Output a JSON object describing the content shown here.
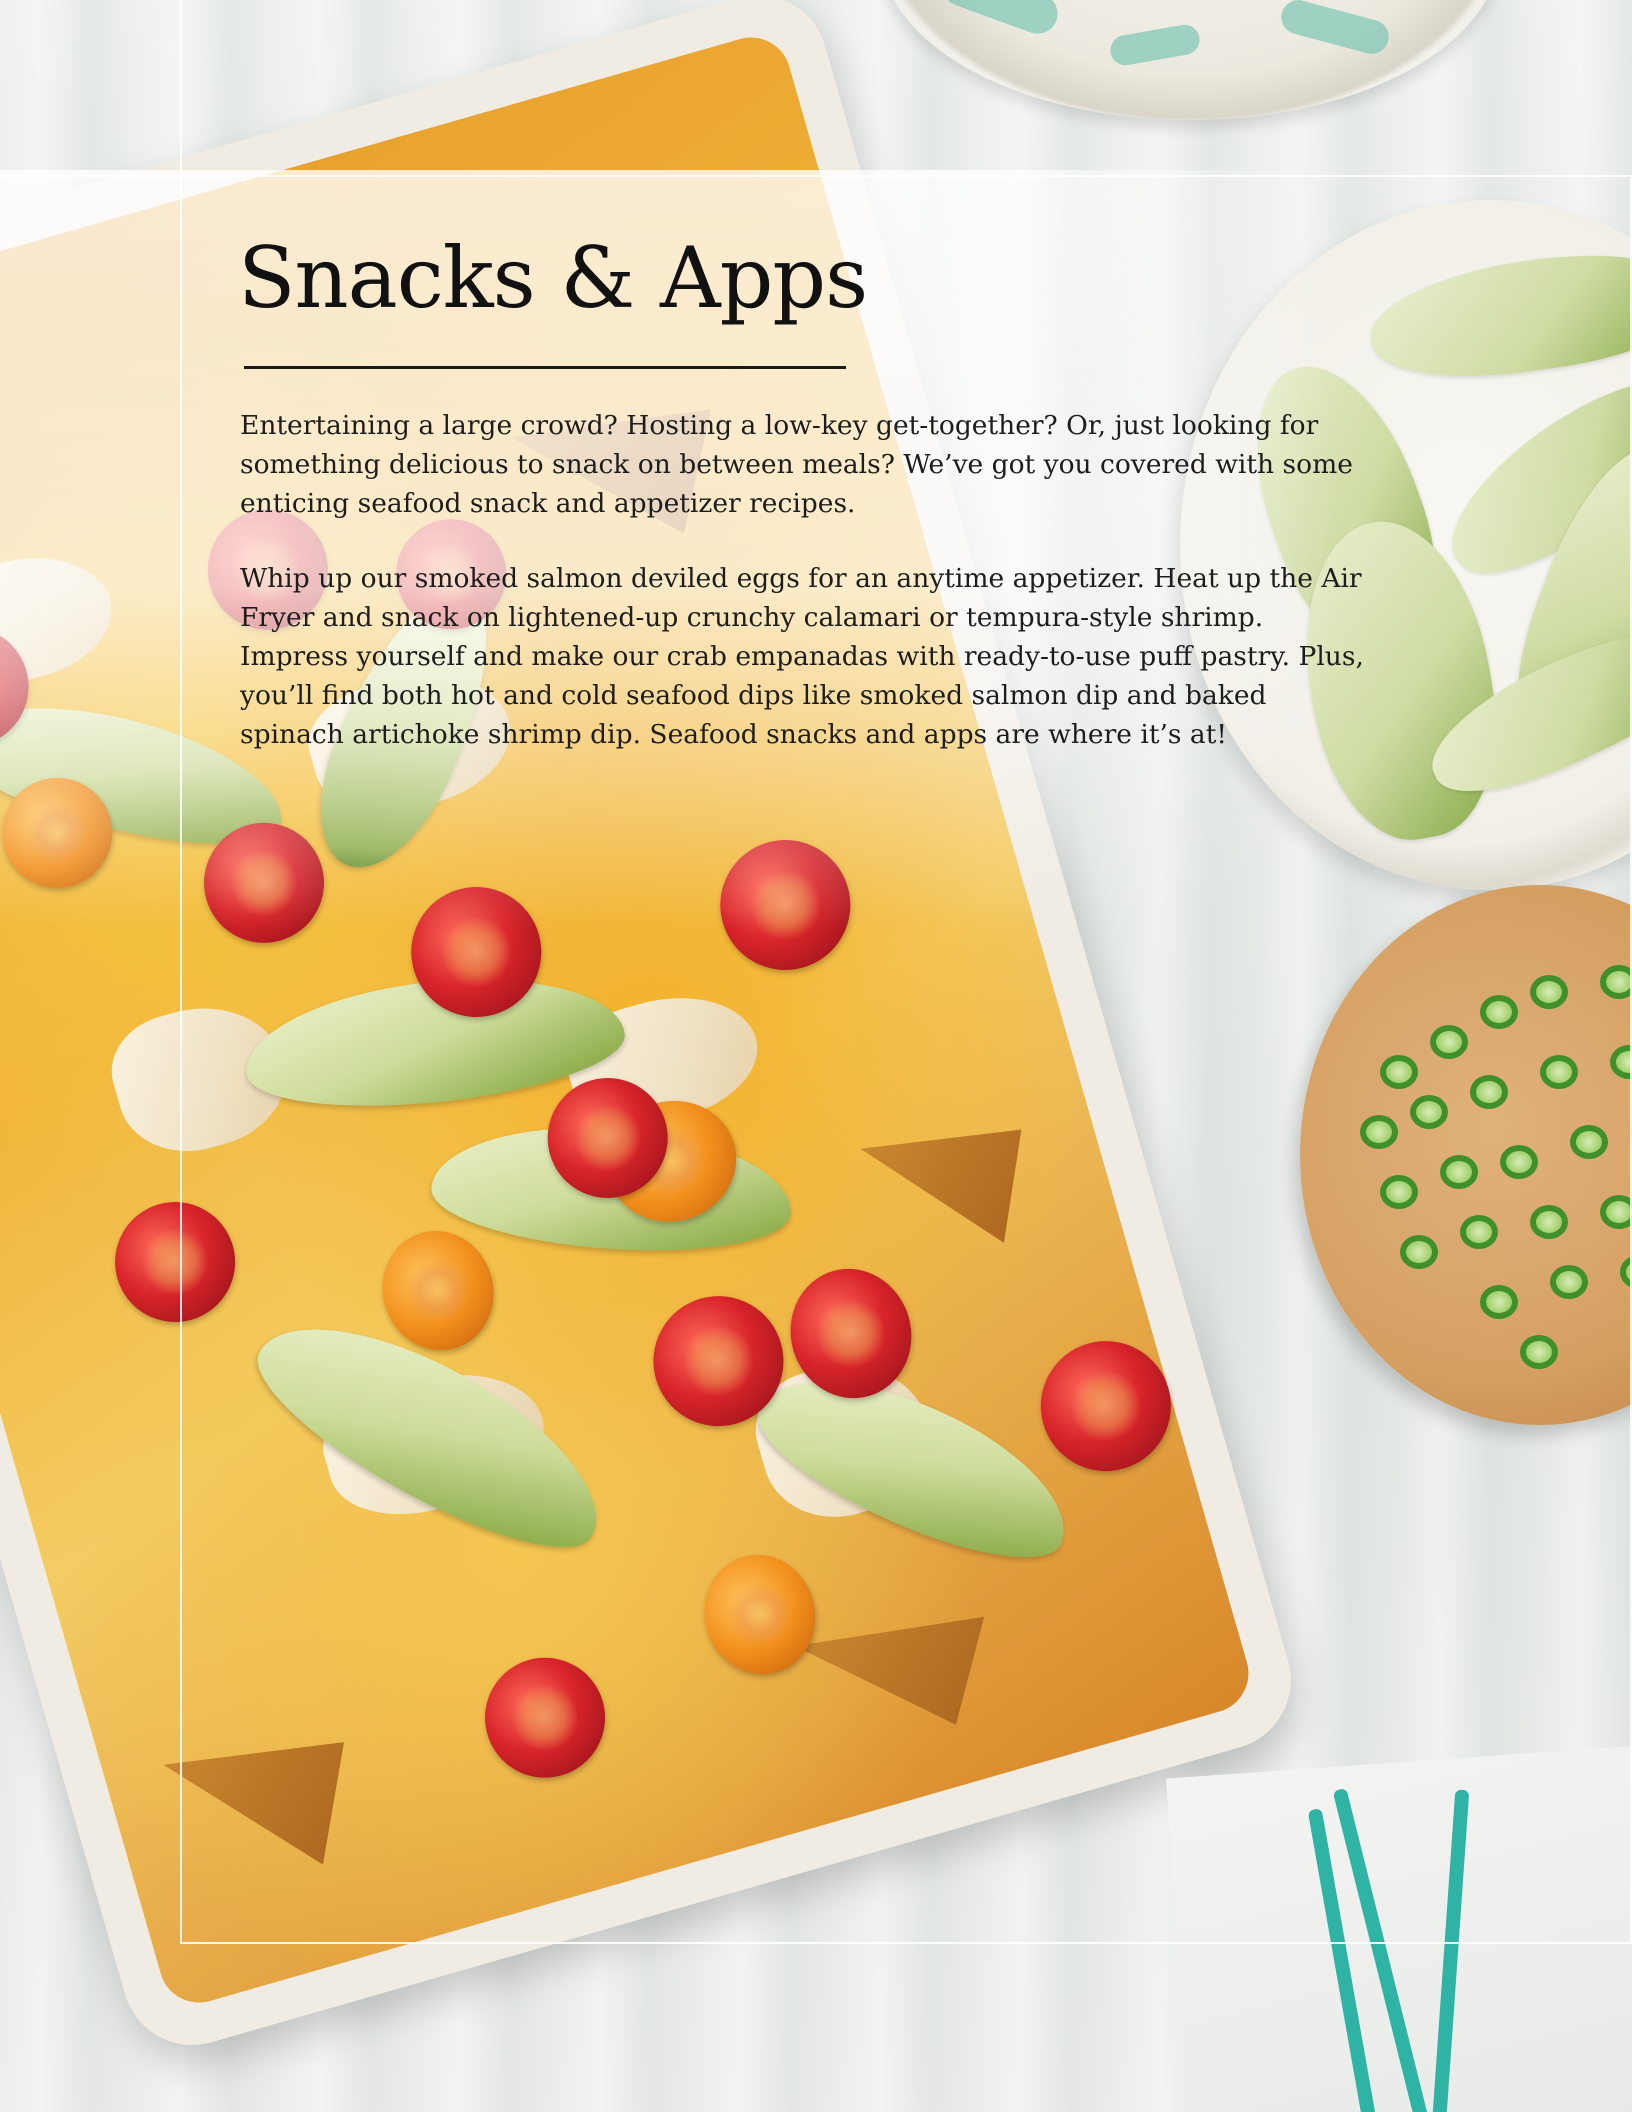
{
  "page": {
    "title": "Snacks & Apps",
    "paragraphs": [
      "Entertaining a large crowd? Hosting a low-key get-together? Or, just looking for something delicious to snack on between meals? We’ve got you covered with some enticing seafood snack and appetizer recipes.",
      "Whip up our smoked salmon deviled eggs for an anytime appetizer. Heat up the Air Fryer and snack on lightened-up crunchy calamari or tempura-style shrimp. Impress yourself and make our crab empanadas with ready-to-use puff pastry. Plus, you’ll find both hot and cold seafood dips like smoked salmon dip and baked spinach artichoke shrimp dip. Seafood snacks and apps are where it’s at!"
    ]
  },
  "colors": {
    "text": "#1d1d1d",
    "title": "#111111",
    "towel_stripe": "#2fb3a4",
    "tray": "#f0ece4"
  }
}
